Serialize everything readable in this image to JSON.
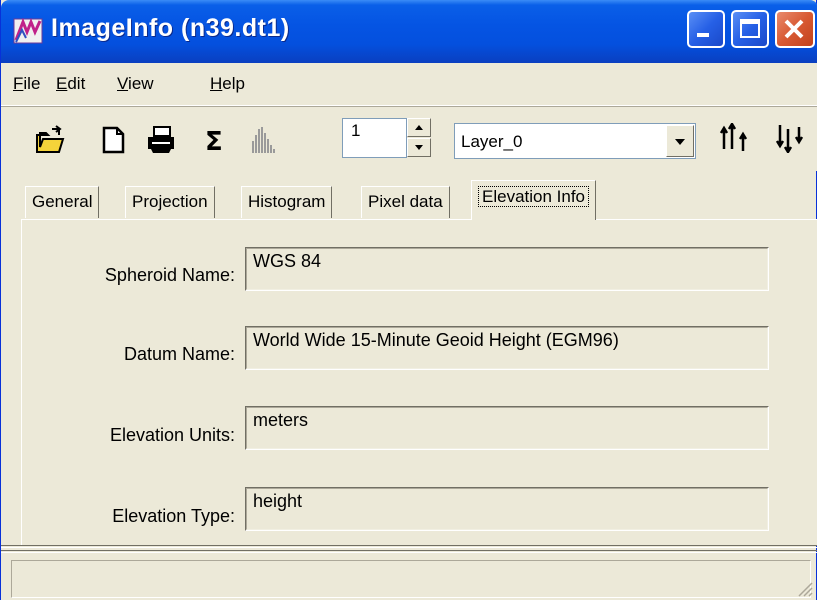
{
  "window": {
    "title": "ImageInfo (n39.dt1)"
  },
  "menu": [
    {
      "label": "File",
      "u": "F",
      "rest": "ile"
    },
    {
      "label": "Edit",
      "u": "E",
      "rest": "dit"
    },
    {
      "label": "View",
      "u": "V",
      "rest": "iew"
    },
    {
      "label": "Help",
      "u": "H",
      "rest": "elp"
    }
  ],
  "toolbar": {
    "band_spin_value": "1",
    "layer_select": "Layer_0",
    "icons": [
      "open-folder-icon",
      "new-document-icon",
      "print-icon",
      "sum-icon",
      "histogram-icon",
      "sort-ascending-icon",
      "sort-descending-icon"
    ]
  },
  "tabs": [
    "General",
    "Projection",
    "Histogram",
    "Pixel data",
    "Elevation Info"
  ],
  "active_tab": "Elevation Info",
  "elevation": {
    "spheroid_label": "Spheroid Name:",
    "spheroid_value": "WGS 84",
    "datum_label": "Datum Name:",
    "datum_value": "World Wide 15-Minute Geoid Height (EGM96)",
    "units_label": "Elevation Units:",
    "units_value": "meters",
    "type_label": "Elevation Type:",
    "type_value": "height"
  },
  "status": ""
}
